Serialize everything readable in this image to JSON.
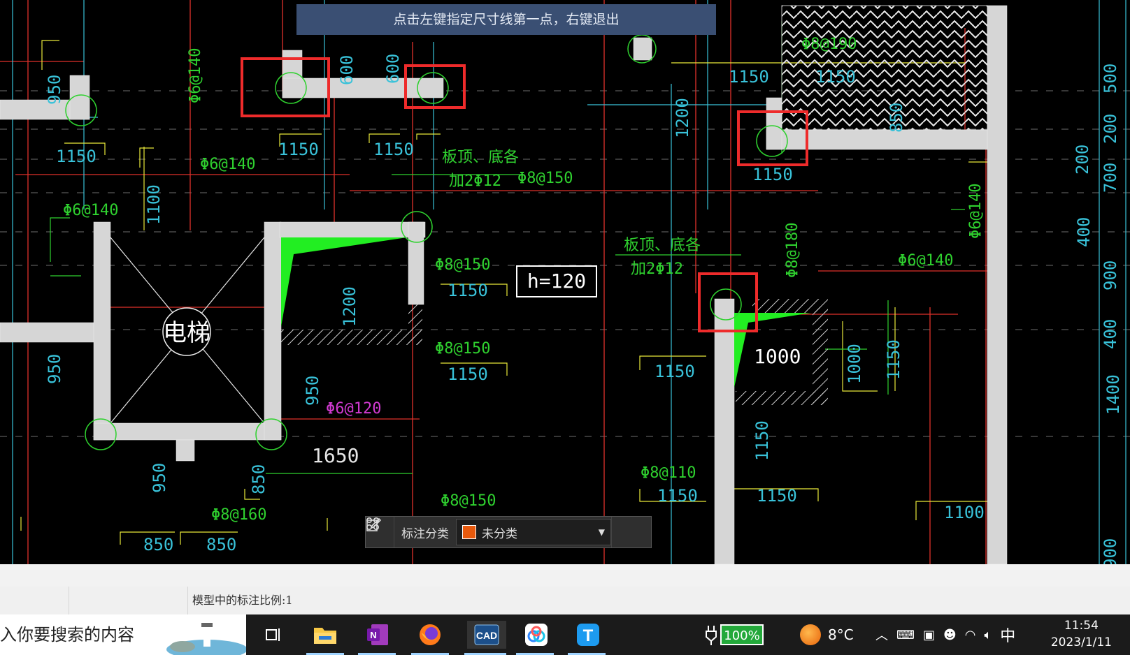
{
  "prompt": "点击左键指定尺寸线第一点，右键退出",
  "drawing": {
    "h_label": "h=120",
    "elevator": "电梯",
    "dims": [
      "1150",
      "1150",
      "1150",
      "950",
      "950",
      "1650",
      "850",
      "850",
      "1100",
      "1200",
      "1000",
      "1000",
      "600",
      "600",
      "1200",
      "850",
      "500",
      "200",
      "700",
      "400",
      "900",
      "400",
      "1400",
      "900",
      "200",
      "1100"
    ],
    "rebar": [
      "Φ6@140",
      "Φ6@140",
      "Φ6@140",
      "Φ6@140",
      "Φ8@150",
      "Φ8@150",
      "Φ8@150",
      "Φ8@150",
      "Φ8@190",
      "Φ8@180",
      "Φ8@160",
      "Φ8@110",
      "Φ6@140",
      "Φ6@120"
    ],
    "notes": [
      "板顶、底各",
      "加2Φ12",
      "板顶、底各",
      "加2Φ12"
    ]
  },
  "annotation_toolbar": {
    "label": "标注分类",
    "selected": "未分类",
    "swatch_color": "#e8590c"
  },
  "status": {
    "scale_text": "模型中的标注比例:1"
  },
  "taskbar": {
    "search_text": "入你要搜索的内容",
    "battery": "100%",
    "temperature": "8°C",
    "ime": "中",
    "time": "11:54",
    "date": "2023/1/11"
  },
  "icons": [
    "grid-icon",
    "edit-icon",
    "task-view-icon",
    "file-explorer-icon",
    "onenote-icon",
    "firefox-icon",
    "cad-icon",
    "baidu-netdisk-icon",
    "tencent-icon",
    "weather-icon",
    "chevron-up-icon",
    "wifi-icon",
    "volume-icon"
  ]
}
